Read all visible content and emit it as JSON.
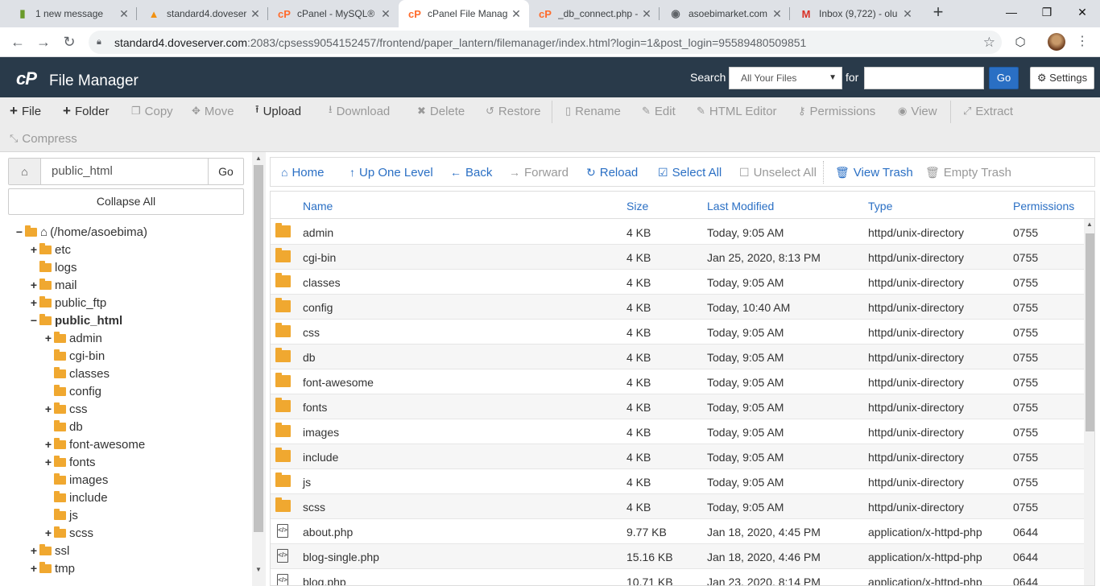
{
  "browser": {
    "tabs": [
      {
        "title": "1 new message",
        "favicon": "bar-chart-icon",
        "favicon_glyph": "▮",
        "favicon_color": "#6a9a2a"
      },
      {
        "title": "standard4.doveser",
        "favicon": "phpmyadmin-icon",
        "favicon_glyph": "▲",
        "favicon_color": "#f29111"
      },
      {
        "title": "cPanel - MySQL®",
        "favicon": "cpanel-icon",
        "favicon_glyph": "cP",
        "favicon_color": "#ff6c2c"
      },
      {
        "title": "cPanel File Manag",
        "favicon": "cpanel-icon",
        "favicon_glyph": "cP",
        "favicon_color": "#ff6c2c"
      },
      {
        "title": "_db_connect.php -",
        "favicon": "cpanel-icon",
        "favicon_glyph": "cP",
        "favicon_color": "#ff6c2c"
      },
      {
        "title": "asoebimarket.com",
        "favicon": "globe-icon",
        "favicon_glyph": "◉",
        "favicon_color": "#5f6368"
      },
      {
        "title": "Inbox (9,722) - olu",
        "favicon": "gmail-icon",
        "favicon_glyph": "M",
        "favicon_color": "#d93025"
      }
    ],
    "new_tab": "+",
    "url_host": "standard4.doveserver.com",
    "url_path": ":2083/cpsess9054152457/frontend/paper_lantern/filemanager/index.html?login=1&post_login=95589480509851"
  },
  "header": {
    "logo": "cP",
    "title": "File Manager",
    "search_label": "Search",
    "search_scope": "All Your Files",
    "for_label": "for",
    "go_label": "Go",
    "settings_label": "Settings"
  },
  "toolbar": {
    "file": "File",
    "folder": "Folder",
    "copy": "Copy",
    "move": "Move",
    "upload": "Upload",
    "download": "Download",
    "delete": "Delete",
    "restore": "Restore",
    "rename": "Rename",
    "edit": "Edit",
    "html_editor": "HTML Editor",
    "permissions": "Permissions",
    "view": "View",
    "extract": "Extract",
    "compress": "Compress"
  },
  "left": {
    "path": "public_html",
    "go": "Go",
    "collapse_all": "Collapse All",
    "tree": [
      {
        "label": "(/home/asoebima)",
        "toggle": "−",
        "depth": 0,
        "bold": false,
        "home": true
      },
      {
        "label": "etc",
        "toggle": "+",
        "depth": 1,
        "bold": false
      },
      {
        "label": "logs",
        "toggle": "",
        "depth": 1,
        "bold": false
      },
      {
        "label": "mail",
        "toggle": "+",
        "depth": 1,
        "bold": false
      },
      {
        "label": "public_ftp",
        "toggle": "+",
        "depth": 1,
        "bold": false
      },
      {
        "label": "public_html",
        "toggle": "−",
        "depth": 1,
        "bold": true
      },
      {
        "label": "admin",
        "toggle": "+",
        "depth": 2,
        "bold": false
      },
      {
        "label": "cgi-bin",
        "toggle": "",
        "depth": 2,
        "bold": false
      },
      {
        "label": "classes",
        "toggle": "",
        "depth": 2,
        "bold": false
      },
      {
        "label": "config",
        "toggle": "",
        "depth": 2,
        "bold": false
      },
      {
        "label": "css",
        "toggle": "+",
        "depth": 2,
        "bold": false
      },
      {
        "label": "db",
        "toggle": "",
        "depth": 2,
        "bold": false
      },
      {
        "label": "font-awesome",
        "toggle": "+",
        "depth": 2,
        "bold": false
      },
      {
        "label": "fonts",
        "toggle": "+",
        "depth": 2,
        "bold": false
      },
      {
        "label": "images",
        "toggle": "",
        "depth": 2,
        "bold": false
      },
      {
        "label": "include",
        "toggle": "",
        "depth": 2,
        "bold": false
      },
      {
        "label": "js",
        "toggle": "",
        "depth": 2,
        "bold": false
      },
      {
        "label": "scss",
        "toggle": "+",
        "depth": 2,
        "bold": false
      },
      {
        "label": "ssl",
        "toggle": "+",
        "depth": 1,
        "bold": false
      },
      {
        "label": "tmp",
        "toggle": "+",
        "depth": 1,
        "bold": false
      }
    ]
  },
  "actions": {
    "home": "Home",
    "up_one_level": "Up One Level",
    "back": "Back",
    "forward": "Forward",
    "reload": "Reload",
    "select_all": "Select All",
    "unselect_all": "Unselect All",
    "view_trash": "View Trash",
    "empty_trash": "Empty Trash"
  },
  "table": {
    "columns": [
      "Name",
      "Size",
      "Last Modified",
      "Type",
      "Permissions"
    ],
    "rows": [
      {
        "icon": "folder-icon",
        "name": "admin",
        "size": "4 KB",
        "modified": "Today, 9:05 AM",
        "type": "httpd/unix-directory",
        "perms": "0755"
      },
      {
        "icon": "folder-icon",
        "name": "cgi-bin",
        "size": "4 KB",
        "modified": "Jan 25, 2020, 8:13 PM",
        "type": "httpd/unix-directory",
        "perms": "0755"
      },
      {
        "icon": "folder-icon",
        "name": "classes",
        "size": "4 KB",
        "modified": "Today, 9:05 AM",
        "type": "httpd/unix-directory",
        "perms": "0755"
      },
      {
        "icon": "folder-icon",
        "name": "config",
        "size": "4 KB",
        "modified": "Today, 10:40 AM",
        "type": "httpd/unix-directory",
        "perms": "0755"
      },
      {
        "icon": "folder-icon",
        "name": "css",
        "size": "4 KB",
        "modified": "Today, 9:05 AM",
        "type": "httpd/unix-directory",
        "perms": "0755"
      },
      {
        "icon": "folder-icon",
        "name": "db",
        "size": "4 KB",
        "modified": "Today, 9:05 AM",
        "type": "httpd/unix-directory",
        "perms": "0755"
      },
      {
        "icon": "folder-icon",
        "name": "font-awesome",
        "size": "4 KB",
        "modified": "Today, 9:05 AM",
        "type": "httpd/unix-directory",
        "perms": "0755"
      },
      {
        "icon": "folder-icon",
        "name": "fonts",
        "size": "4 KB",
        "modified": "Today, 9:05 AM",
        "type": "httpd/unix-directory",
        "perms": "0755"
      },
      {
        "icon": "folder-icon",
        "name": "images",
        "size": "4 KB",
        "modified": "Today, 9:05 AM",
        "type": "httpd/unix-directory",
        "perms": "0755"
      },
      {
        "icon": "folder-icon",
        "name": "include",
        "size": "4 KB",
        "modified": "Today, 9:05 AM",
        "type": "httpd/unix-directory",
        "perms": "0755"
      },
      {
        "icon": "folder-icon",
        "name": "js",
        "size": "4 KB",
        "modified": "Today, 9:05 AM",
        "type": "httpd/unix-directory",
        "perms": "0755"
      },
      {
        "icon": "folder-icon",
        "name": "scss",
        "size": "4 KB",
        "modified": "Today, 9:05 AM",
        "type": "httpd/unix-directory",
        "perms": "0755"
      },
      {
        "icon": "php-file-icon",
        "name": "about.php",
        "size": "9.77 KB",
        "modified": "Jan 18, 2020, 4:45 PM",
        "type": "application/x-httpd-php",
        "perms": "0644"
      },
      {
        "icon": "php-file-icon",
        "name": "blog-single.php",
        "size": "15.16 KB",
        "modified": "Jan 18, 2020, 4:46 PM",
        "type": "application/x-httpd-php",
        "perms": "0644"
      },
      {
        "icon": "php-file-icon",
        "name": "blog.php",
        "size": "10.71 KB",
        "modified": "Jan 23, 2020, 8:14 PM",
        "type": "application/x-httpd-php",
        "perms": "0644"
      }
    ]
  },
  "colors": {
    "header_bg": "#293a4a",
    "link_blue": "#2a6fc4",
    "folder": "#f0a830"
  }
}
